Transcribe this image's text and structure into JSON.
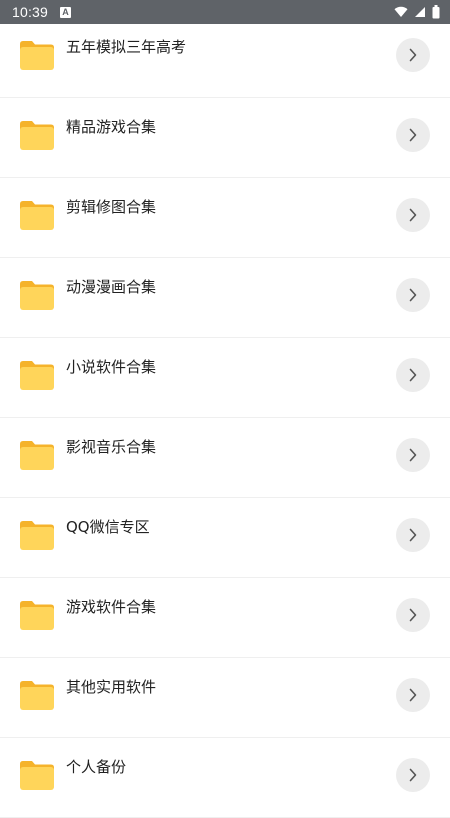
{
  "status_bar": {
    "time": "10:39",
    "notification_icon": "a-badge-icon",
    "icons": [
      "wifi-icon",
      "signal-icon",
      "battery-icon"
    ]
  },
  "colors": {
    "status_bar_bg": "#5f6368",
    "folder_front": "#ffd55a",
    "folder_back": "#f5b32b",
    "chevron_bg": "#ececec",
    "divider": "#efefef"
  },
  "folders": [
    {
      "label": "五年模拟三年高考"
    },
    {
      "label": "精品游戏合集"
    },
    {
      "label": "剪辑修图合集"
    },
    {
      "label": "动漫漫画合集"
    },
    {
      "label": "小说软件合集"
    },
    {
      "label": "影视音乐合集"
    },
    {
      "label": "QQ微信专区"
    },
    {
      "label": "游戏软件合集"
    },
    {
      "label": "其他实用软件"
    },
    {
      "label": "个人备份"
    }
  ]
}
